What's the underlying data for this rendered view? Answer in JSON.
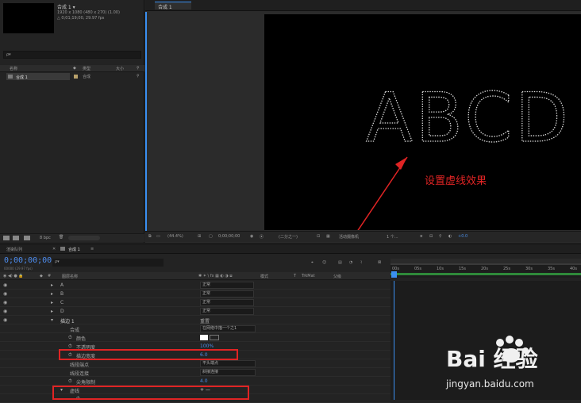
{
  "project": {
    "comp_name": "合成 1 ▾",
    "comp_info1": "1920 x 1080 (480 x 270) (1.00)",
    "comp_info2": "△ 0;01;19;00, 29.97 fps",
    "search_placeholder": "ρ▾",
    "col_name": "名称",
    "col_type": "类型",
    "col_size": "大小",
    "item_name": "合成 1",
    "item_type": "合成",
    "bpc": "8 bpc"
  },
  "viewer": {
    "tab": "合成 1",
    "letters": "ABCD",
    "annotation": "设置虚线效果",
    "zoom": "(44.4%)",
    "timecode": "0;00;00;00",
    "resolution": "(二分之一)",
    "camera": "活动摄像机",
    "views": "1 个...",
    "exposure": "+0.0"
  },
  "timeline": {
    "tab_render": "渲染队列",
    "tab_comp": "合成 1",
    "current_time": "0;00;00;00",
    "fps_note": "00000 (29.97 fps)",
    "col_layer_name": "图层名称",
    "col_mode": "模式",
    "col_trkmat": "TrkMat",
    "col_parent": "父级",
    "layers": [
      {
        "name": "A",
        "mode": "正常"
      },
      {
        "name": "B",
        "mode": "正常"
      },
      {
        "name": "C",
        "mode": "正常"
      },
      {
        "name": "D",
        "mode": "正常"
      }
    ],
    "effect_name": "描边 1",
    "composite_label": "合成",
    "composite_value": "在网络中描一个之1",
    "color_label": "颜色",
    "opacity_label": "不透明度",
    "opacity_value": "100%",
    "stroke_width_label": "描边宽度",
    "stroke_width_value": "6.0",
    "line_cap_label": "线段端点",
    "line_cap_value": "平头端点",
    "line_join_label": "线段连接",
    "line_join_value": "斜接连接",
    "miter_label": "尖角限制",
    "miter_value": "4.0",
    "dashes_label": "虚线",
    "dashes_controls": "+ —",
    "ruler_ticks": [
      "00s",
      "05s",
      "10s",
      "15s",
      "20s",
      "25s",
      "30s",
      "35s",
      "40s"
    ]
  },
  "watermark": {
    "brand": "Bai 经验",
    "url": "jingyan.baidu.com"
  },
  "colors": {
    "accent_blue": "#3a8ff0",
    "annotation_red": "#e02424",
    "track_green": "#2f8a3a"
  }
}
